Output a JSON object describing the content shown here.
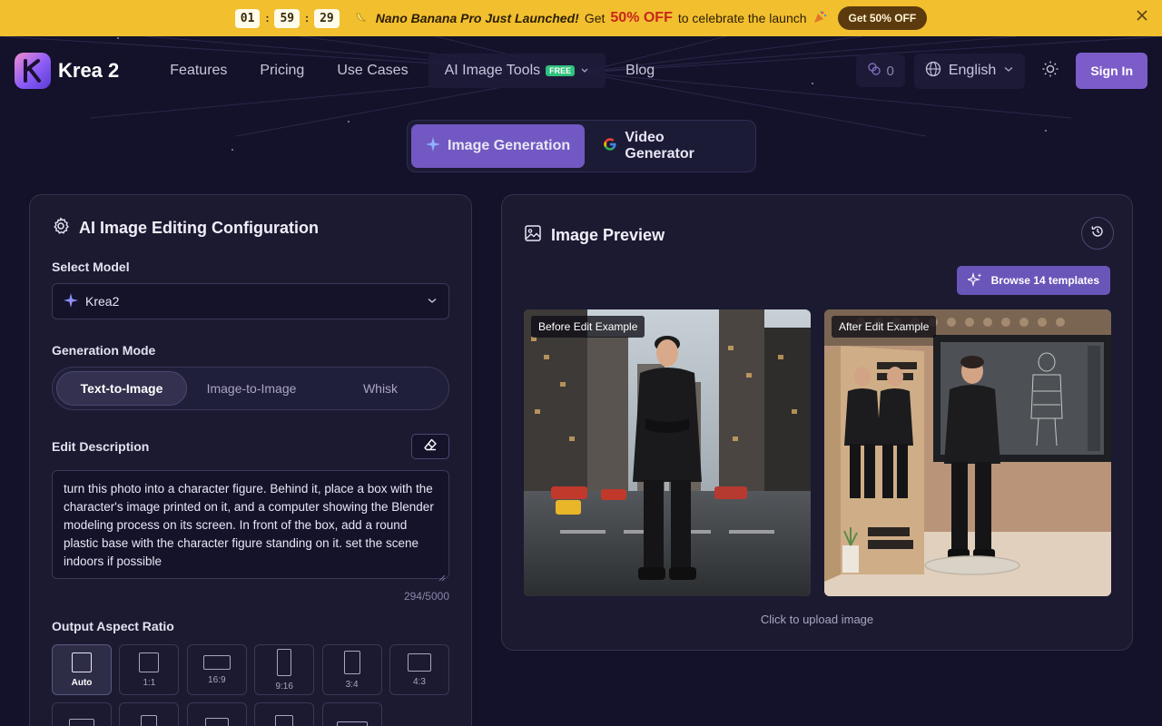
{
  "promo": {
    "timer": [
      "01",
      "59",
      "29"
    ],
    "headline": "Nano Banana Pro Just Launched!",
    "get": "Get",
    "discount": "50% OFF",
    "tail": "to celebrate the launch",
    "cta": "Get 50% OFF"
  },
  "nav": {
    "brand": "Krea 2",
    "links": [
      "Features",
      "Pricing",
      "Use Cases",
      "AI Image Tools",
      "Blog"
    ],
    "free_badge": "FREE",
    "credits": "0",
    "language": "English",
    "sign_in": "Sign In"
  },
  "mode_switch": {
    "image_generation": "Image Generation",
    "video_generator": "Video Generator"
  },
  "config": {
    "title": "AI Image Editing Configuration",
    "model_label": "Select Model",
    "model_value": "Krea2",
    "mode_label": "Generation Mode",
    "modes": [
      "Text-to-Image",
      "Image-to-Image",
      "Whisk"
    ],
    "active_mode": "Text-to-Image",
    "description_label": "Edit Description",
    "description_text": "turn this photo into a character figure. Behind it, place a box with the character's image printed on it, and a computer showing the Blender modeling process on its screen. In front of the box, add a round plastic base with the character figure standing on it. set the scene indoors if possible",
    "char_counter": "294/5000",
    "aspect_label": "Output Aspect Ratio",
    "aspect_ratios": [
      "Auto",
      "1:1",
      "16:9",
      "9:16",
      "3:4",
      "4:3"
    ]
  },
  "preview": {
    "title": "Image Preview",
    "browse_templates": "Browse 14 templates",
    "before_label": "Before Edit Example",
    "after_label": "After Edit Example",
    "upload_hint": "Click to upload image"
  },
  "colors": {
    "accent": "#7258c2",
    "banner": "#f2bf2f",
    "background": "#13122a",
    "panel": "#1b1a31"
  }
}
